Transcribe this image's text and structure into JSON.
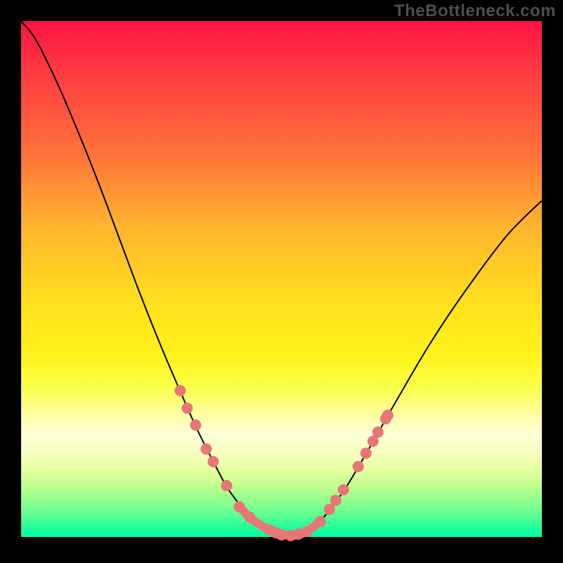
{
  "watermark": "TheBottleneck.com",
  "colors": {
    "background_frame": "#000000",
    "curve_stroke": "#000000",
    "dot_fill": "#e87676",
    "thick_stroke": "#e87676"
  },
  "chart_data": {
    "type": "line",
    "title": "",
    "xlabel": "",
    "ylabel": "",
    "xlim": [
      30,
      770
    ],
    "ylim": [
      30,
      763
    ],
    "series": [
      {
        "name": "bottleneck-curve",
        "x": [
          30,
          50,
          80,
          110,
          140,
          170,
          200,
          230,
          260,
          280,
          300,
          320,
          335,
          350,
          365,
          380,
          395,
          410,
          425,
          440,
          460,
          490,
          520,
          560,
          610,
          660,
          720,
          770
        ],
        "y": [
          30,
          55,
          115,
          185,
          260,
          340,
          420,
          495,
          565,
          610,
          650,
          688,
          710,
          728,
          742,
          752,
          760,
          762,
          760,
          752,
          735,
          695,
          645,
          575,
          490,
          415,
          335,
          285
        ]
      }
    ],
    "markers": [
      {
        "x": 256,
        "y": 555
      },
      {
        "x": 266,
        "y": 580
      },
      {
        "x": 278,
        "y": 604
      },
      {
        "x": 293,
        "y": 638
      },
      {
        "x": 303,
        "y": 656
      },
      {
        "x": 322,
        "y": 690
      },
      {
        "x": 340,
        "y": 720
      },
      {
        "x": 355,
        "y": 735
      },
      {
        "x": 383,
        "y": 753
      },
      {
        "x": 392,
        "y": 757
      },
      {
        "x": 400,
        "y": 760
      },
      {
        "x": 413,
        "y": 761
      },
      {
        "x": 424,
        "y": 759
      },
      {
        "x": 436,
        "y": 755
      },
      {
        "x": 455,
        "y": 741
      },
      {
        "x": 468,
        "y": 724
      },
      {
        "x": 477,
        "y": 711
      },
      {
        "x": 488,
        "y": 696
      },
      {
        "x": 509,
        "y": 663
      },
      {
        "x": 520,
        "y": 644
      },
      {
        "x": 530,
        "y": 627
      },
      {
        "x": 537,
        "y": 614
      },
      {
        "x": 548,
        "y": 595
      },
      {
        "x": 551,
        "y": 590
      }
    ],
    "thick_segment": {
      "x": [
        340,
        355,
        370,
        385,
        400,
        415,
        430,
        445,
        455
      ],
      "y": [
        720,
        735,
        746,
        754,
        759,
        761,
        758,
        749,
        741
      ]
    }
  }
}
